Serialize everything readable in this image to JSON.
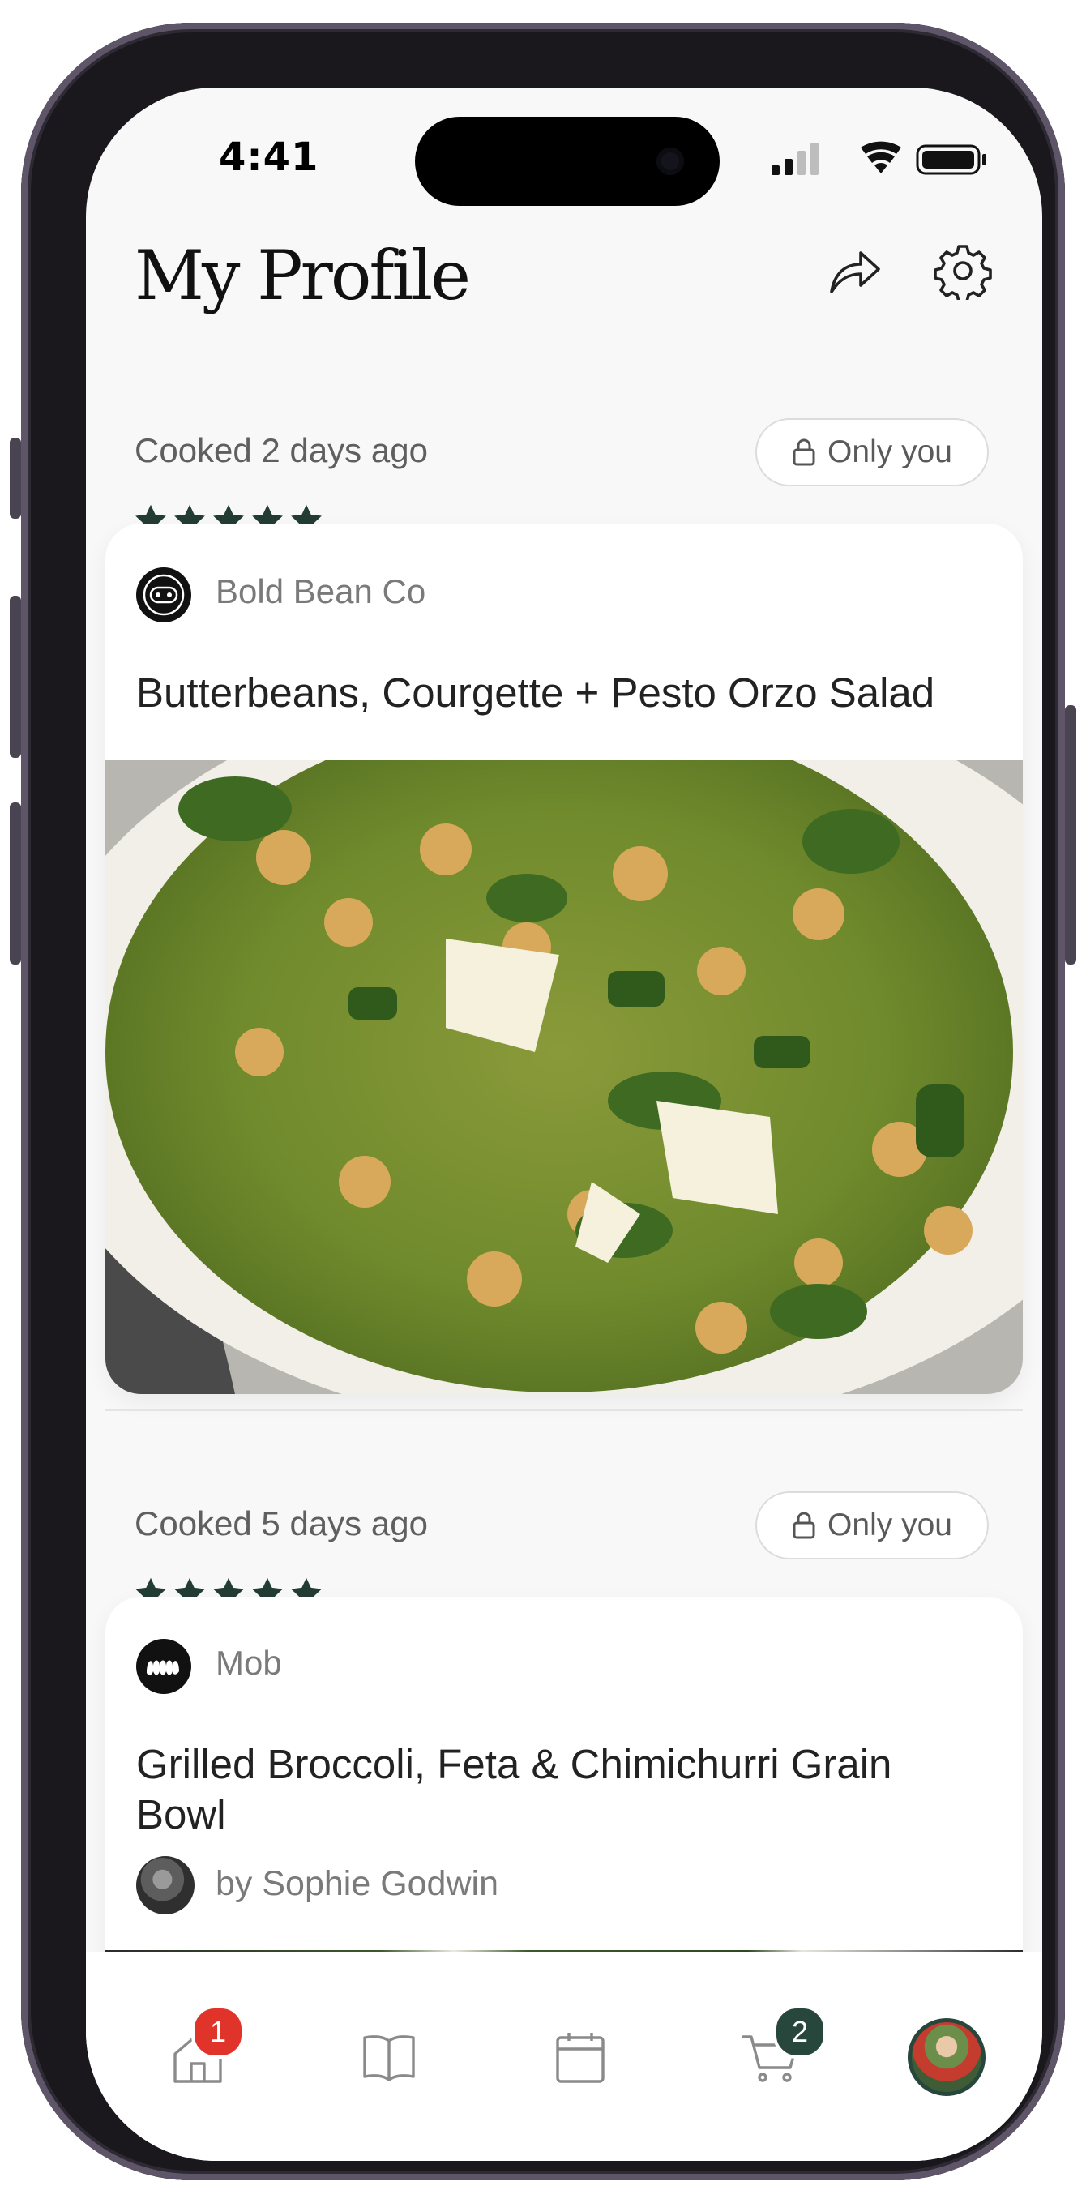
{
  "status_bar": {
    "time": "4:41"
  },
  "header": {
    "title": "My Profile",
    "share_icon": "share-arrow-icon",
    "settings_icon": "gear-icon"
  },
  "feed": [
    {
      "cooked_text": "Cooked 2 days ago",
      "privacy_label": "Only you",
      "rating": 5,
      "brand": "Bold Bean Co",
      "title": "Butterbeans, Courgette + Pesto Orzo Salad",
      "photo": "pesto-orzo-salad-photo"
    },
    {
      "cooked_text": "Cooked 5 days ago",
      "privacy_label": "Only you",
      "rating": 5,
      "brand": "Mob",
      "title": "Grilled Broccoli, Feta & Chimichurri Grain Bowl",
      "author": "by Sophie Godwin",
      "photo": "broccoli-grain-bowl-photo"
    }
  ],
  "tab_bar": {
    "items": [
      {
        "name": "home",
        "icon": "home-icon",
        "badge": "1"
      },
      {
        "name": "cookbooks",
        "icon": "book-icon"
      },
      {
        "name": "planner",
        "icon": "calendar-icon"
      },
      {
        "name": "shopping",
        "icon": "cart-icon",
        "badge": "2"
      },
      {
        "name": "profile",
        "icon": "avatar"
      }
    ]
  },
  "colors": {
    "accent_dark_green": "#28473c",
    "notification_red": "#e0342b",
    "star_color": "#233d35"
  }
}
